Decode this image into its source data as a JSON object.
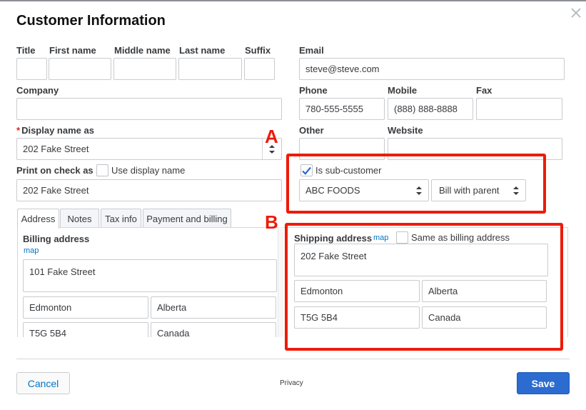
{
  "dialog": {
    "title": "Customer Information",
    "privacy_link": "Privacy",
    "cancel_label": "Cancel",
    "save_label": "Save"
  },
  "name_fields": {
    "title_label": "Title",
    "first_name_label": "First name",
    "middle_name_label": "Middle name",
    "last_name_label": "Last name",
    "suffix_label": "Suffix",
    "title_value": "",
    "first_name_value": "",
    "middle_name_value": "",
    "last_name_value": "",
    "suffix_value": ""
  },
  "company": {
    "label": "Company",
    "value": ""
  },
  "display_name": {
    "required_mark": "*",
    "label": "Display name as",
    "value": "202 Fake Street"
  },
  "print_on_check": {
    "label": "Print on check as",
    "use_display_name_label": "Use display name",
    "use_display_name_checked": false,
    "value": "202 Fake Street"
  },
  "contact": {
    "email_label": "Email",
    "email_value": "steve@steve.com",
    "phone_label": "Phone",
    "phone_value": "780-555-5555",
    "mobile_label": "Mobile",
    "mobile_value": "(888) 888-8888",
    "fax_label": "Fax",
    "fax_value": "",
    "other_label": "Other",
    "other_value": "",
    "website_label": "Website",
    "website_value": ""
  },
  "sub_customer": {
    "checkbox_label": "Is sub-customer",
    "checked": true,
    "parent_value": "ABC FOODS",
    "billing_option": "Bill with parent"
  },
  "tabs": [
    {
      "label": "Address",
      "active": true
    },
    {
      "label": "Notes",
      "active": false
    },
    {
      "label": "Tax info",
      "active": false
    },
    {
      "label": "Payment and billing",
      "active": false
    }
  ],
  "billing_address": {
    "label": "Billing address",
    "map_link": "map",
    "street": "101 Fake Street",
    "city": "Edmonton",
    "province": "Alberta",
    "postal_code": "T5G 5B4",
    "country": "Canada"
  },
  "shipping_address": {
    "label": "Shipping address",
    "map_link": "map",
    "same_as_billing_label": "Same as billing address",
    "same_as_billing_checked": false,
    "street": "202 Fake Street",
    "city": "Edmonton",
    "province": "Alberta",
    "postal_code": "T5G 5B4",
    "country": "Canada"
  },
  "annotations": {
    "marker_a": "A",
    "marker_b": "B",
    "highlight_color": "#ec1c0a"
  },
  "colors": {
    "accent_blue": "#2c6bcf",
    "link_blue": "#0077c5",
    "cancel_text": "#0077c5"
  }
}
